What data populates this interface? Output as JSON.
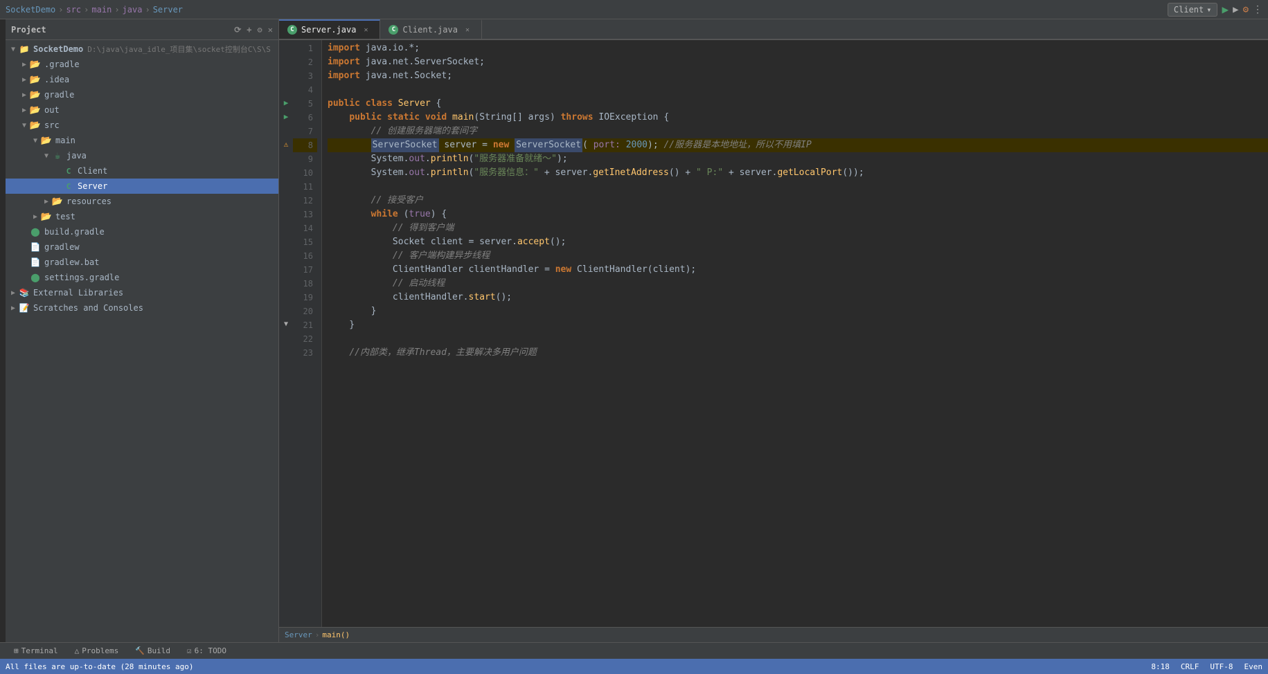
{
  "titleBar": {
    "project": "SocketDemo",
    "sep1": "›",
    "src": "src",
    "sep2": "›",
    "main": "main",
    "sep3": "›",
    "java": "java",
    "sep4": "›",
    "className": "Server",
    "runConfig": "Client",
    "chevron": "▾"
  },
  "sidebar": {
    "header": "Project",
    "items": [
      {
        "id": "socketdemo-root",
        "label": "SocketDemo",
        "indent": 0,
        "type": "project",
        "path": "D:\\java\\java_idle_项目集\\socket控制台C\\S\\S",
        "expanded": true
      },
      {
        "id": "gradle-folder",
        "label": ".gradle",
        "indent": 1,
        "type": "folder",
        "expanded": false
      },
      {
        "id": "idea-folder",
        "label": ".idea",
        "indent": 1,
        "type": "folder",
        "expanded": false
      },
      {
        "id": "gradle-folder2",
        "label": "gradle",
        "indent": 1,
        "type": "folder",
        "expanded": false
      },
      {
        "id": "out-folder",
        "label": "out",
        "indent": 1,
        "type": "folder",
        "expanded": false
      },
      {
        "id": "src-folder",
        "label": "src",
        "indent": 1,
        "type": "folder",
        "expanded": true
      },
      {
        "id": "main-folder",
        "label": "main",
        "indent": 2,
        "type": "folder",
        "expanded": true
      },
      {
        "id": "java-folder",
        "label": "java",
        "indent": 3,
        "type": "folder-java",
        "expanded": true
      },
      {
        "id": "client-file",
        "label": "Client",
        "indent": 4,
        "type": "java"
      },
      {
        "id": "server-file",
        "label": "Server",
        "indent": 4,
        "type": "java"
      },
      {
        "id": "resources-folder",
        "label": "resources",
        "indent": 3,
        "type": "folder",
        "expanded": false
      },
      {
        "id": "test-folder",
        "label": "test",
        "indent": 2,
        "type": "folder",
        "expanded": false
      },
      {
        "id": "build-gradle",
        "label": "build.gradle",
        "indent": 1,
        "type": "gradle"
      },
      {
        "id": "gradlew",
        "label": "gradlew",
        "indent": 1,
        "type": "file-green"
      },
      {
        "id": "gradlew-bat",
        "label": "gradlew.bat",
        "indent": 1,
        "type": "file"
      },
      {
        "id": "settings-gradle",
        "label": "settings.gradle",
        "indent": 1,
        "type": "gradle"
      },
      {
        "id": "external-libs",
        "label": "External Libraries",
        "indent": 0,
        "type": "folder",
        "expanded": false
      },
      {
        "id": "scratches",
        "label": "Scratches and Consoles",
        "indent": 0,
        "type": "folder",
        "expanded": false
      }
    ]
  },
  "tabs": [
    {
      "id": "server-tab",
      "label": "Server.java",
      "active": true,
      "type": "java"
    },
    {
      "id": "client-tab",
      "label": "Client.java",
      "active": false,
      "type": "java"
    }
  ],
  "code": {
    "lines": [
      {
        "num": 1,
        "content": "import java.io.*;",
        "gutter": ""
      },
      {
        "num": 2,
        "content": "import java.net.ServerSocket;",
        "gutter": ""
      },
      {
        "num": 3,
        "content": "import java.net.Socket;",
        "gutter": ""
      },
      {
        "num": 4,
        "content": "",
        "gutter": ""
      },
      {
        "num": 5,
        "content": "public class Server {",
        "gutter": "run"
      },
      {
        "num": 6,
        "content": "    public static void main(String[] args) throws IOException {",
        "gutter": "run"
      },
      {
        "num": 7,
        "content": "        // 创建服务器端的套间字",
        "gutter": ""
      },
      {
        "num": 8,
        "content": "        ServerSocket server = new ServerSocket( port: 2000); //服务器是本地地址，所以不用填IP",
        "gutter": "warn"
      },
      {
        "num": 9,
        "content": "        System.out.println(\"服务器准备就绪～\");",
        "gutter": ""
      },
      {
        "num": 10,
        "content": "        System.out.println(\"服务器信息：\" + server.getInetAddress() + \" P:\" + server.getLocalPort());",
        "gutter": ""
      },
      {
        "num": 11,
        "content": "",
        "gutter": ""
      },
      {
        "num": 12,
        "content": "        // 接受客户",
        "gutter": ""
      },
      {
        "num": 13,
        "content": "        while (true) {",
        "gutter": ""
      },
      {
        "num": 14,
        "content": "            // 得到客户端",
        "gutter": ""
      },
      {
        "num": 15,
        "content": "            Socket client = server.accept();",
        "gutter": ""
      },
      {
        "num": 16,
        "content": "            // 客户端构建异步线程",
        "gutter": ""
      },
      {
        "num": 17,
        "content": "            ClientHandler clientHandler = new ClientHandler(client);",
        "gutter": ""
      },
      {
        "num": 18,
        "content": "            // 启动线程",
        "gutter": ""
      },
      {
        "num": 19,
        "content": "            clientHandler.start();",
        "gutter": ""
      },
      {
        "num": 20,
        "content": "        }",
        "gutter": ""
      },
      {
        "num": 21,
        "content": "    }",
        "gutter": "fold"
      },
      {
        "num": 22,
        "content": "",
        "gutter": ""
      },
      {
        "num": 23,
        "content": "    //内部类，继承Thread，主要解决多用户问题",
        "gutter": ""
      }
    ]
  },
  "bottomTabs": [
    {
      "id": "terminal",
      "label": "Terminal",
      "icon": "terminal"
    },
    {
      "id": "problems",
      "label": "Problems",
      "icon": "problems"
    },
    {
      "id": "build",
      "label": "Build",
      "icon": "build"
    },
    {
      "id": "todo",
      "label": "6: TODO",
      "icon": "todo"
    }
  ],
  "statusBar": {
    "message": "All files are up-to-date (28 minutes ago)",
    "lineCol": "8:18",
    "lineEnding": "CRLF",
    "encoding": "UTF-8",
    "event": "Even"
  },
  "breadcrumbBar": {
    "server": "Server",
    "sep": "›",
    "method": "main()"
  }
}
